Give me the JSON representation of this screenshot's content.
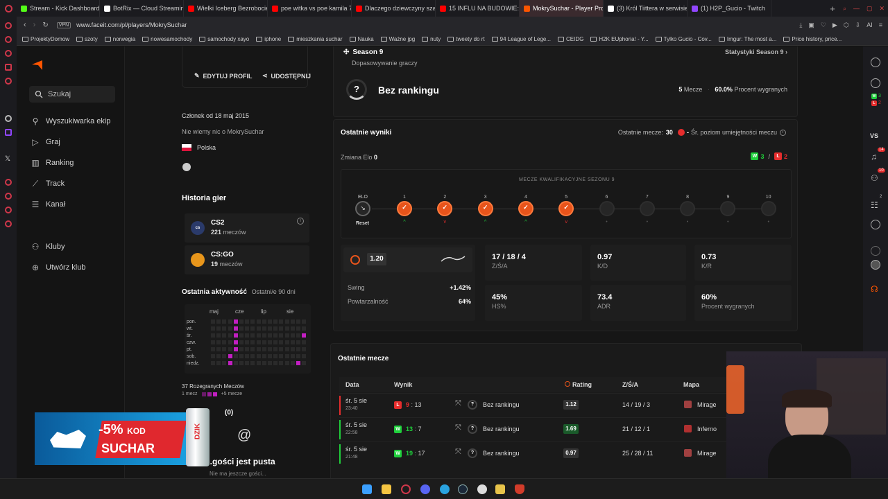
{
  "browser": {
    "tabs": [
      {
        "label": "Stream - Kick Dashboard",
        "color": "#53fc18"
      },
      {
        "label": "BotRix — Cloud Streaming",
        "color": "#ffffff"
      },
      {
        "label": "Wielki Iceberg Bezrobocie",
        "color": "#ff0000"
      },
      {
        "label": "poe witka vs poe kamila 7",
        "color": "#ff0000"
      },
      {
        "label": "Dlaczego dziewczyny szan",
        "color": "#ff0000"
      },
      {
        "label": "15 INFLU NA BUDOWIE: Le",
        "color": "#ff0000"
      },
      {
        "label": "MokrySuchar - Player Profi",
        "color": "#ff5500",
        "active": true
      },
      {
        "label": "(3) Król Tiittera w serwisie",
        "color": "#ffffff"
      },
      {
        "label": "(1) H2P_Gucio - Twitch",
        "color": "#9146ff"
      }
    ],
    "vpn_label": "VPN",
    "url": "www.faceit.com/pl/players/MokrySuchar",
    "bookmarks": [
      "ProjektyDomow",
      "szoty",
      "norwegia",
      "nowesamochody",
      "samochody xayo",
      "iphone",
      "mieszkania suchar",
      "Nauka",
      "Ważne jpg",
      "nuty",
      "tweety do rt",
      "94 League of Lege...",
      "CEIDG",
      "H2K EUphoria! - Y...",
      "Tylko Gucio - Cov...",
      "Imgur: The most a...",
      "Price history, price..."
    ]
  },
  "nav": {
    "search_placeholder": "Szukaj",
    "items": [
      "Wyszukiwarka ekip",
      "Graj",
      "Ranking",
      "Track",
      "Kanał"
    ],
    "items2": [
      "Kluby",
      "Utwórz klub"
    ]
  },
  "profile": {
    "edit_label": "EDYTUJ PROFIL",
    "share_label": "UDOSTĘPNIJ",
    "member_since": "Członek od 18 maj 2015",
    "about": "Nie wiemy nic o MokrySuchar",
    "country": "Polska",
    "history_title": "Historia gier",
    "games": [
      {
        "name": "CS2",
        "count": "221",
        "count_label": "meczów",
        "icon": "cs2"
      },
      {
        "name": "CS:GO",
        "count": "19",
        "count_label": "meczów",
        "icon": "csgo"
      }
    ],
    "activity_title": "Ostatnia aktywność",
    "activity_sub": "Ostatni/e 90 dni",
    "months": [
      "maj",
      "cze",
      "lip",
      "sie"
    ],
    "days": [
      "pon.",
      "wt.",
      "śr.",
      "czw.",
      "pt.",
      "sob.",
      "niedz."
    ],
    "played_label": "37 Rozegranych Meczów",
    "legend_min": "1 mecz",
    "legend_max": "+5 mecze",
    "friends_label": "(0)",
    "friends_empty": "...gości jest pusta",
    "friends_sub": "Nie ma jeszcze gości..."
  },
  "season": {
    "title": "Season 9",
    "subtitle": "Dopasowywanie graczy",
    "stats_link": "Statystyki Season 9",
    "rank": "Bez rankingu",
    "matches_value": "5",
    "matches_label": "Mecze",
    "winrate_value": "60.0%",
    "winrate_label": "Procent wygranych"
  },
  "recent": {
    "title": "Ostatnie wyniki",
    "last_matches_label": "Ostatnie mecze:",
    "last_matches_value": "30",
    "avg_label": "Śr. poziom umiejętności meczu",
    "avg_value": "-",
    "elo_change_label": "Zmiana Elo",
    "elo_change_value": "0",
    "wins": "3",
    "losses": "2",
    "qual_title": "MECZE KWALIFIKACYJNE SEZONU 9",
    "elo_label": "ELO",
    "reset_label": "Reset",
    "nodes": [
      {
        "n": "1",
        "state": "win",
        "trend": "up"
      },
      {
        "n": "2",
        "state": "win",
        "trend": "down"
      },
      {
        "n": "3",
        "state": "win",
        "trend": "up"
      },
      {
        "n": "4",
        "state": "win",
        "trend": "up"
      },
      {
        "n": "5",
        "state": "win",
        "trend": "down"
      },
      {
        "n": "6",
        "state": "empty"
      },
      {
        "n": "7",
        "state": "empty"
      },
      {
        "n": "8",
        "state": "empty"
      },
      {
        "n": "9",
        "state": "empty"
      },
      {
        "n": "10",
        "state": "empty"
      }
    ],
    "rating_value": "1.20",
    "swing_label": "Swing",
    "swing_value": "+1.42%",
    "repeat_label": "Powtarzalność",
    "repeat_value": "64%",
    "stats": [
      {
        "value": "17 / 18 / 4",
        "label": "Z/Ś/A"
      },
      {
        "value": "0.97",
        "label": "K/D"
      },
      {
        "value": "0.73",
        "label": "K/R"
      },
      {
        "value": "45%",
        "label": "HS%"
      },
      {
        "value": "73.4",
        "label": "ADR"
      },
      {
        "value": "60%",
        "label": "Procent wygranych"
      }
    ]
  },
  "matches": {
    "title": "Ostatnie mecze",
    "headers": [
      "Data",
      "Wynik",
      "Rating",
      "Z/Ś/A",
      "Mapa"
    ],
    "rows": [
      {
        "day": "śr. 5 sie",
        "time": "23:40",
        "result": "L",
        "score_a": "9",
        "score_b": "13",
        "rank": "Bez rankingu",
        "rating": "1.12",
        "kda": "14 / 19 / 3",
        "map": "Mirage"
      },
      {
        "day": "śr. 5 sie",
        "time": "22:58",
        "result": "W",
        "score_a": "13",
        "score_b": "7",
        "rank": "Bez rankingu",
        "rating": "1.69",
        "kda": "21 / 12 / 1",
        "map": "Inferno"
      },
      {
        "day": "śr. 5 sie",
        "time": "21:48",
        "result": "W",
        "score_a": "19",
        "score_b": "17",
        "rank": "Bez rankingu",
        "rating": "0.97",
        "kda": "25 / 28 / 11",
        "map": "Mirage"
      }
    ]
  },
  "ad": {
    "discount": "-5%",
    "code_label": "KOD",
    "code": "SUCHAR",
    "brand": "DZIK"
  },
  "right_panel": {
    "vs_label": "VS",
    "badge_w": "3",
    "badge_l": "2",
    "notif_count": "14",
    "friends_count": "10",
    "party_count": "2"
  },
  "colors": {
    "accent": "#ff5500",
    "win": "#1fcf3b",
    "loss": "#e62d2d",
    "activity": "#c21fc2"
  }
}
